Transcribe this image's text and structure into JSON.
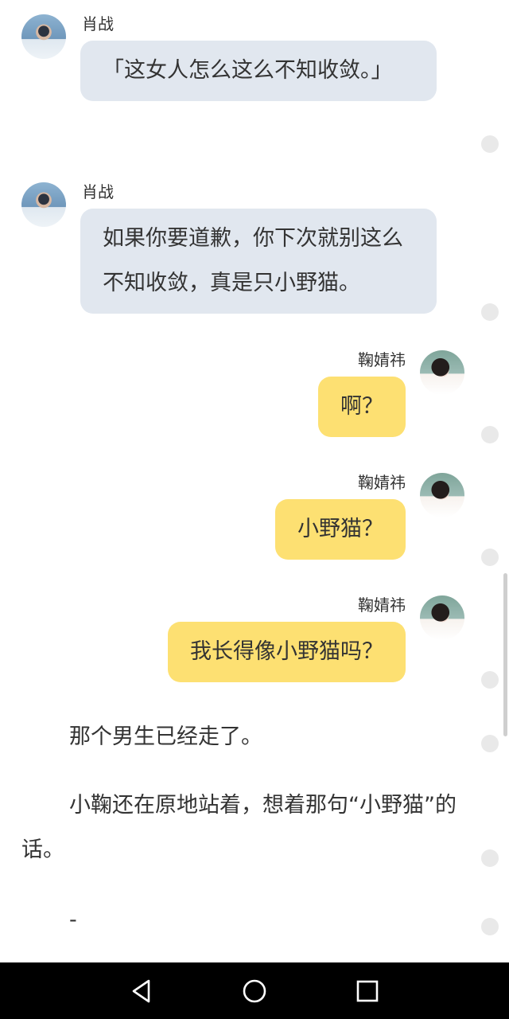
{
  "messages": [
    {
      "side": "left",
      "sender": "肖战",
      "text": "「这女人怎么这么不知收敛。」"
    },
    {
      "side": "left",
      "sender": "肖战",
      "text": "如果你要道歉，你下次就别这么不知收敛，真是只小野猫。"
    },
    {
      "side": "right",
      "sender": "鞠婧祎",
      "text": "啊？"
    },
    {
      "side": "right",
      "sender": "鞠婧祎",
      "text": "小野猫？"
    },
    {
      "side": "right",
      "sender": "鞠婧祎",
      "text": "我长得像小野猫吗？"
    }
  ],
  "narration": {
    "p1": "那个男生已经走了。",
    "p2": "小鞠还在原地站着，想着那句“小野猫”的话。",
    "p3": "-"
  },
  "colors": {
    "left_bubble": "#e1e7ef",
    "right_bubble": "#fde072",
    "text": "#333333",
    "navbar": "#000000"
  },
  "navbar": {
    "back": "back-triangle-icon",
    "home": "home-circle-icon",
    "recents": "recents-square-icon"
  }
}
